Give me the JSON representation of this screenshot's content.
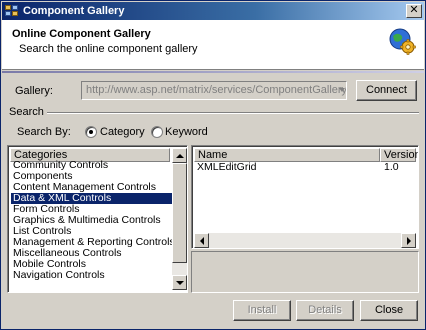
{
  "window": {
    "title": "Component Gallery",
    "close_glyph": "✕"
  },
  "header": {
    "title": "Online Component Gallery",
    "subtitle": "Search the online component gallery",
    "icon": "globe-gear-icon"
  },
  "gallery": {
    "label": "Gallery:",
    "url": "http://www.asp.net/matrix/services/ComponentGalleryService.a",
    "connect_label": "Connect"
  },
  "search": {
    "section_label": "Search",
    "search_by_label": "Search By:",
    "options": [
      {
        "label": "Category",
        "checked": true
      },
      {
        "label": "Keyword",
        "checked": false
      }
    ]
  },
  "categories": {
    "header": "Categories",
    "selected": "Data & XML Controls",
    "items": [
      "Community Controls",
      "Components",
      "Content Management Controls",
      "Data & XML Controls",
      "Form Controls",
      "Graphics & Multimedia Controls",
      "List Controls",
      "Management & Reporting Controls",
      "Miscellaneous Controls",
      "Mobile Controls",
      "Navigation Controls"
    ]
  },
  "results": {
    "columns": [
      "Name",
      "Version"
    ],
    "rows": [
      {
        "name": "XMLEditGrid",
        "version": "1.0"
      }
    ]
  },
  "footer": {
    "install_label": "Install",
    "details_label": "Details",
    "close_label": "Close"
  },
  "colors": {
    "selection": "#0a246a",
    "face": "#d4d0c8",
    "title_gradient_start": "#0a246a"
  }
}
